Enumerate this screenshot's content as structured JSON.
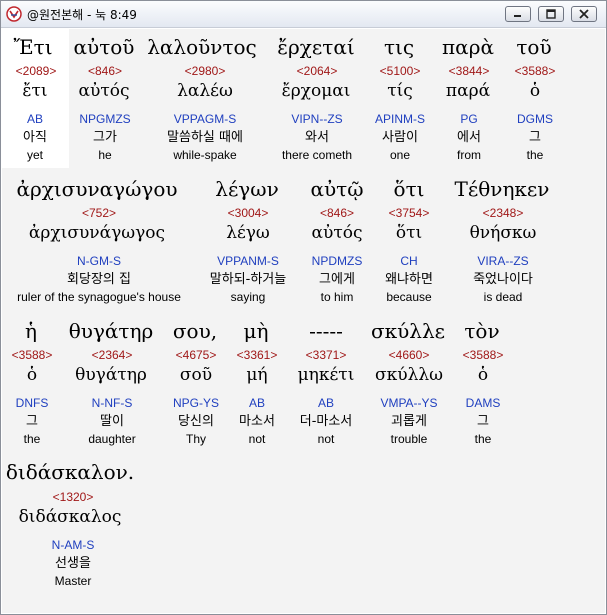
{
  "window": {
    "title": "@원전본해 - 눅 8:49"
  },
  "rows": [
    {
      "words": [
        {
          "greek": "Ἔτι",
          "strong": "<2089>",
          "lemma": "ἔτι",
          "parse": "AB",
          "kor": "아직",
          "eng": "yet"
        },
        {
          "greek": "αὐτοῦ",
          "strong": "<846>",
          "lemma": "αὐτός",
          "parse": "NPGMZS",
          "kor": "그가",
          "eng": "he"
        },
        {
          "greek": "λαλοῦντος",
          "strong": "<2980>",
          "lemma": "λαλέω",
          "parse": "VPPAGM-S",
          "kor": "말씀하실 때에",
          "eng": "while-spake"
        },
        {
          "greek": "ἔρχεταί",
          "strong": "<2064>",
          "lemma": "ἔρχομαι",
          "parse": "VIPN--ZS",
          "kor": "와서",
          "eng": "there cometh"
        },
        {
          "greek": "τις",
          "strong": "<5100>",
          "lemma": "τίς",
          "parse": "APINM-S",
          "kor": "사람이",
          "eng": "one"
        },
        {
          "greek": "παρὰ",
          "strong": "<3844>",
          "lemma": "παρά",
          "parse": "PG",
          "kor": "에서",
          "eng": "from"
        },
        {
          "greek": "τοῦ",
          "strong": "<3588>",
          "lemma": "ὁ",
          "parse": "DGMS",
          "kor": "그",
          "eng": "the"
        }
      ]
    },
    {
      "words": [
        {
          "greek": "ἀρχισυναγώγου",
          "strong": "<752>",
          "lemma": "ἀρχισυνάγωγος",
          "parse": "N-GM-S",
          "kor": "회당장의 집",
          "eng": "ruler of the synagogue's house"
        },
        {
          "greek": "λέγων",
          "strong": "<3004>",
          "lemma": "λέγω",
          "parse": "VPPANM-S",
          "kor": "말하되-하거늘",
          "eng": "saying"
        },
        {
          "greek": "αὐτῷ",
          "strong": "<846>",
          "lemma": "αὐτός",
          "parse": "NPDMZS",
          "kor": "그에게",
          "eng": "to him"
        },
        {
          "greek": "ὅτι",
          "strong": "<3754>",
          "lemma": "ὅτι",
          "parse": "CH",
          "kor": "왜냐하면",
          "eng": "because"
        },
        {
          "greek": "Τέθνηκεν",
          "strong": "<2348>",
          "lemma": "θνήσκω",
          "parse": "VIRA--ZS",
          "kor": "죽었나이다",
          "eng": "is dead"
        }
      ]
    },
    {
      "words": [
        {
          "greek": "ἡ",
          "strong": "<3588>",
          "lemma": "ὁ",
          "parse": "DNFS",
          "kor": "그",
          "eng": "the"
        },
        {
          "greek": "θυγάτηρ",
          "strong": "<2364>",
          "lemma": "θυγάτηρ",
          "parse": "N-NF-S",
          "kor": "딸이",
          "eng": "daughter"
        },
        {
          "greek": "σου,",
          "strong": "<4675>",
          "lemma": "σοῦ",
          "parse": "NPG-YS",
          "kor": "당신의",
          "eng": "Thy"
        },
        {
          "greek": "μὴ",
          "strong": "<3361>",
          "lemma": "μή",
          "parse": "AB",
          "kor": "마소서",
          "eng": "not"
        },
        {
          "greek": "-----",
          "strong": "<3371>",
          "lemma": "μηκέτι",
          "parse": "AB",
          "kor": "더-마소서",
          "eng": "not"
        },
        {
          "greek": "σκύλλε",
          "strong": "<4660>",
          "lemma": "σκύλλω",
          "parse": "VMPA--YS",
          "kor": "괴롭게",
          "eng": "trouble"
        },
        {
          "greek": "τὸν",
          "strong": "<3588>",
          "lemma": "ὁ",
          "parse": "DAMS",
          "kor": "그",
          "eng": "the"
        }
      ]
    },
    {
      "words": [
        {
          "greek": "διδάσκαλον.",
          "strong": "<1320>",
          "lemma": "διδάσκαλος",
          "parse": "N-AM-S",
          "kor": "선생을",
          "eng": "Master"
        }
      ]
    }
  ]
}
